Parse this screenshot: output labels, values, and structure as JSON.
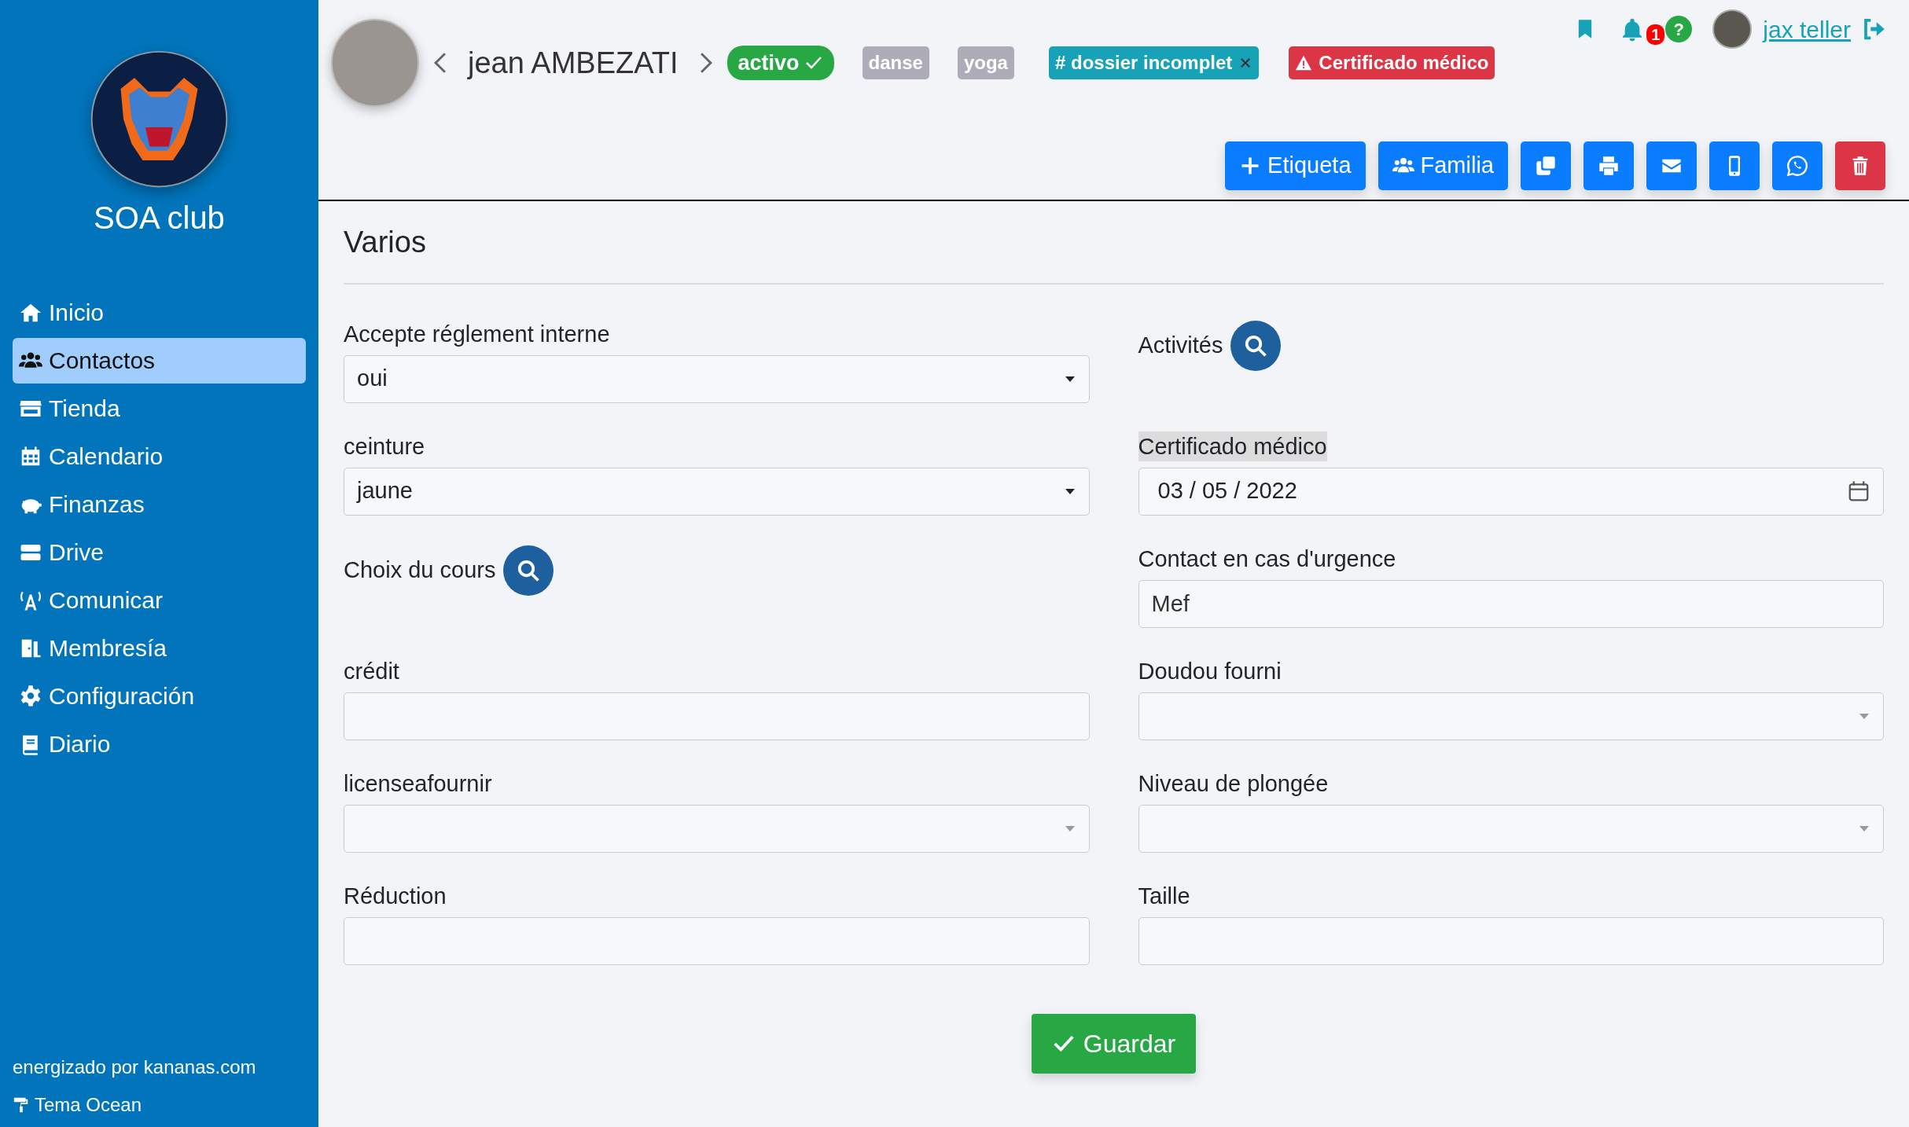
{
  "sidebar": {
    "club_name": "SOA club",
    "items": [
      {
        "label": "Inicio",
        "selected": false
      },
      {
        "label": "Contactos",
        "selected": true
      },
      {
        "label": "Tienda",
        "selected": false
      },
      {
        "label": "Calendario",
        "selected": false
      },
      {
        "label": "Finanzas",
        "selected": false
      },
      {
        "label": "Drive",
        "selected": false
      },
      {
        "label": "Comunicar",
        "selected": false
      },
      {
        "label": "Membresía",
        "selected": false
      },
      {
        "label": "Configuración",
        "selected": false
      },
      {
        "label": "Diario",
        "selected": false
      }
    ],
    "footer": {
      "powered_by": "energizado por kananas.com",
      "theme": "Tema Ocean"
    }
  },
  "header": {
    "contact_name": "jean AMBEZATI",
    "status": "activo",
    "tags": [
      {
        "label": "danse",
        "kind": "plain",
        "color": "#aeacb8"
      },
      {
        "label": "yoga",
        "kind": "plain",
        "color": "#aeacb8"
      },
      {
        "label": "# dossier incomplet",
        "kind": "removable",
        "color": "#17a2b8"
      },
      {
        "label": "Certificado médico",
        "kind": "alert",
        "color": "#dc3545"
      }
    ],
    "user": {
      "name": "jax teller",
      "notifications": "1",
      "help": "?"
    },
    "buttons": [
      {
        "label": "Etiqueta",
        "kind": "primary"
      },
      {
        "label": "Familia",
        "kind": "primary"
      },
      {
        "kind": "primary"
      },
      {
        "kind": "primary"
      },
      {
        "kind": "primary"
      },
      {
        "kind": "primary"
      },
      {
        "kind": "primary"
      },
      {
        "kind": "danger"
      }
    ]
  },
  "form": {
    "title": "Varios",
    "fields": [
      {
        "label": "Accepte réglement interne",
        "kind": "select",
        "value": "oui",
        "highlighted": false
      },
      {
        "label": "Activités",
        "kind": "search",
        "highlighted": false
      },
      {
        "label": "ceinture",
        "kind": "select",
        "value": "jaune",
        "highlighted": false
      },
      {
        "label": "Certificado médico",
        "kind": "date",
        "value": "03 / 05 / 2022",
        "highlighted": true
      },
      {
        "label": "Choix du cours",
        "kind": "search",
        "highlighted": false
      },
      {
        "label": "Contact en cas d'urgence",
        "kind": "text",
        "value": "Mef",
        "highlighted": false
      },
      {
        "label": "crédit",
        "kind": "text",
        "highlighted": false
      },
      {
        "label": "Doudou fourni",
        "kind": "select",
        "highlighted": false
      },
      {
        "label": "licenseafournir",
        "kind": "select",
        "highlighted": false
      },
      {
        "label": "Niveau de plongée",
        "kind": "select",
        "highlighted": false
      },
      {
        "label": "Réduction",
        "kind": "text",
        "highlighted": false
      },
      {
        "label": "Taille",
        "kind": "text",
        "highlighted": false
      }
    ],
    "save_button": "Guardar"
  }
}
